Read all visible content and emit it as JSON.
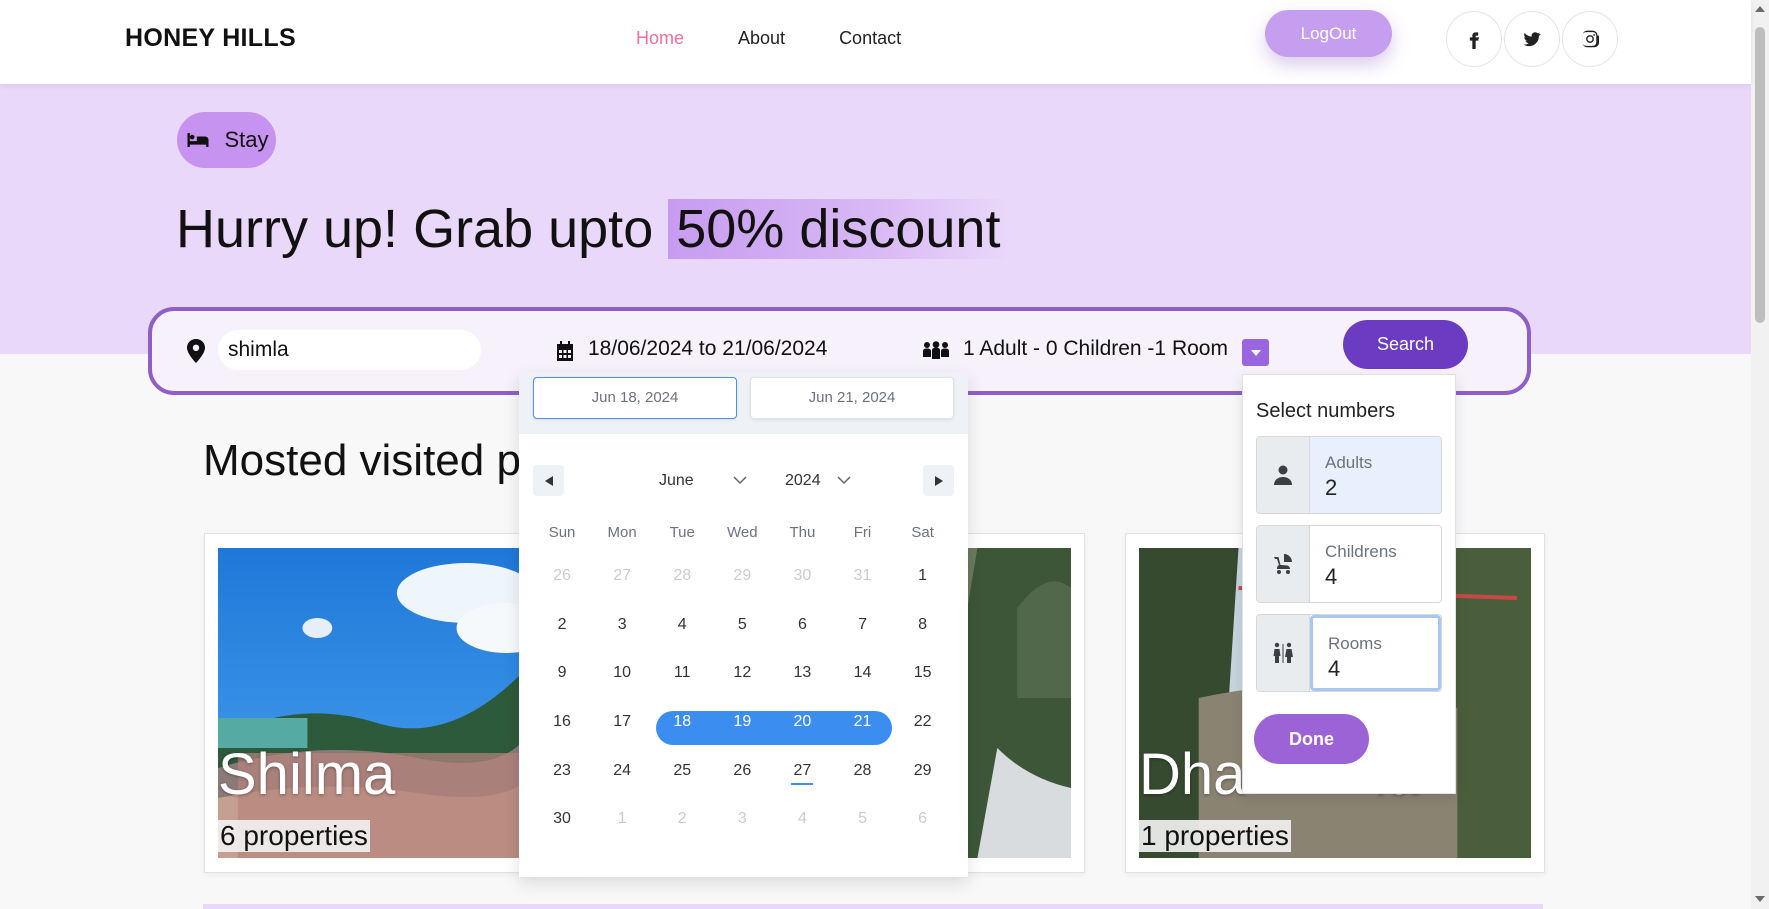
{
  "header": {
    "brand": "HONEY HILLS",
    "nav": [
      {
        "label": "Home",
        "active": true
      },
      {
        "label": "About",
        "active": false
      },
      {
        "label": "Contact",
        "active": false
      }
    ],
    "logout_label": "LogOut",
    "social_icons": [
      "facebook-icon",
      "twitter-icon",
      "instagram-icon"
    ]
  },
  "hero": {
    "stay_label": "Stay",
    "headline_prefix": "Hurry up! Grab upto ",
    "headline_highlight": "50% discount"
  },
  "search": {
    "location_value": "shimla",
    "date_range": "18/06/2024 to 21/06/2024",
    "guests_summary": "1 Adult - 0 Children -1 Room",
    "search_label": "Search"
  },
  "section": {
    "title": "Mosted visited p"
  },
  "cards": [
    {
      "place": "Shilma",
      "properties": "6 properties"
    },
    {
      "place": "",
      "properties": ""
    },
    {
      "place": "Dha",
      "place_tail": "la",
      "properties": "1 properties"
    }
  ],
  "datepicker": {
    "start_field": "Jun 18, 2024",
    "end_field": "Jun 21, 2024",
    "month": "June",
    "year": "2024",
    "weekdays": [
      "Sun",
      "Mon",
      "Tue",
      "Wed",
      "Thu",
      "Fri",
      "Sat"
    ],
    "weeks": [
      [
        "26",
        "27",
        "28",
        "29",
        "30",
        "31",
        "1"
      ],
      [
        "2",
        "3",
        "4",
        "5",
        "6",
        "7",
        "8"
      ],
      [
        "9",
        "10",
        "11",
        "12",
        "13",
        "14",
        "15"
      ],
      [
        "16",
        "17",
        "18",
        "19",
        "20",
        "21",
        "22"
      ],
      [
        "23",
        "24",
        "25",
        "26",
        "27",
        "28",
        "29"
      ],
      [
        "30",
        "1",
        "2",
        "3",
        "4",
        "5",
        "6"
      ]
    ],
    "selected": [
      "18",
      "19",
      "20",
      "21"
    ],
    "today": "27"
  },
  "guests_popup": {
    "title": "Select numbers",
    "adults_label": "Adults",
    "adults_value": "2",
    "children_label": "Childrens",
    "children_value": "4",
    "rooms_label": "Rooms",
    "rooms_value": "4",
    "done_label": "Done"
  },
  "colors": {
    "accent": "#6b3cc2",
    "hero_bg": "#e9d8f9",
    "nav_active": "#ef6fa0",
    "calendar_selected": "#3b8ef0"
  }
}
